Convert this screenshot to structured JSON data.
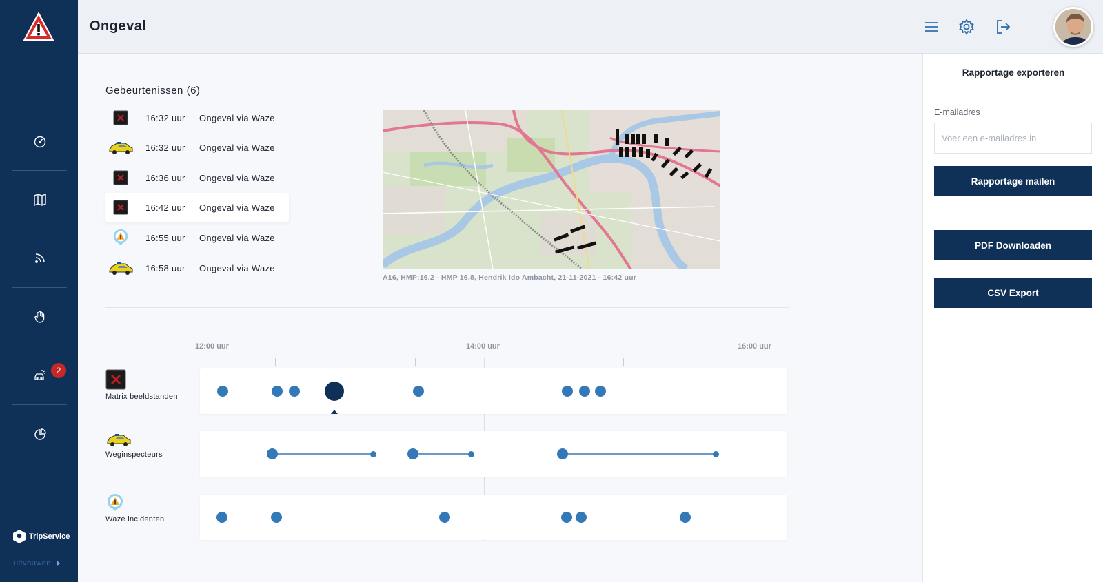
{
  "header": {
    "title": "Ongeval"
  },
  "sidebar": {
    "badge_count": "2",
    "brand": "TripService",
    "expand_label": "uitvouwen"
  },
  "events": {
    "title": "Gebeurtenissen (6)",
    "items": [
      {
        "icon": "matrix-sign-icon",
        "time": "16:32 uur",
        "desc": "Ongeval via Waze"
      },
      {
        "icon": "inspector-car-icon",
        "time": "16:32 uur",
        "desc": "Ongeval via Waze"
      },
      {
        "icon": "matrix-sign-icon",
        "time": "16:36 uur",
        "desc": "Ongeval via Waze"
      },
      {
        "icon": "matrix-sign-icon",
        "time": "16:42 uur",
        "desc": "Ongeval via Waze",
        "active": true
      },
      {
        "icon": "waze-warning-icon",
        "time": "16:55 uur",
        "desc": "Ongeval via Waze"
      },
      {
        "icon": "inspector-car-icon",
        "time": "16:58 uur",
        "desc": "Ongeval via Waze"
      }
    ]
  },
  "map": {
    "caption": "A16, HMP:16.2 - HMP 16.8, Hendrik Ido Ambacht, 21-11-2021 - 16:42 uur"
  },
  "timeline": {
    "labels": [
      "12:00 uur",
      "14:00 uur",
      "16:00 uur"
    ],
    "lanes": [
      {
        "name": "Matrix beeldstanden"
      },
      {
        "name": "Weginspecteurs"
      },
      {
        "name": "Waze incidenten"
      }
    ]
  },
  "export": {
    "title": "Rapportage exporteren",
    "email_label": "E-mailadres",
    "email_placeholder": "Voer een e-mailadres in",
    "email_value": "",
    "mail_button": "Rapportage mailen",
    "pdf_button": "PDF Downloaden",
    "csv_button": "CSV Export"
  },
  "colors": {
    "navy": "#0f3057",
    "dot_blue": "#3379b8",
    "badge_red": "#c62828"
  }
}
